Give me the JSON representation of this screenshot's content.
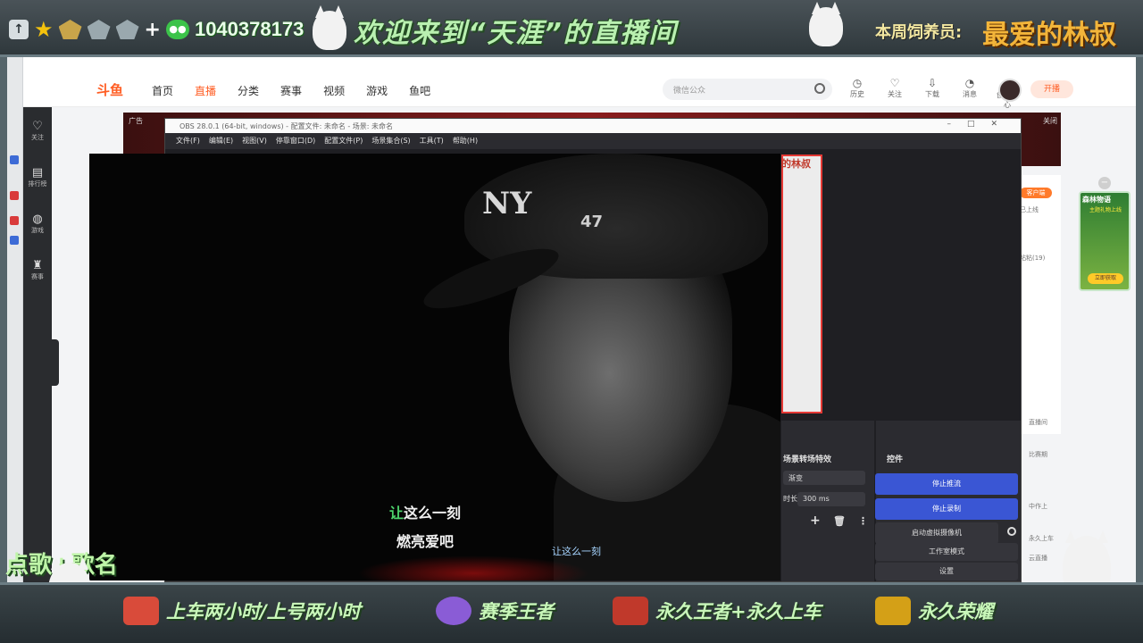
{
  "overlay": {
    "wechat_number": "1040378173",
    "welcome": "欢迎来到“天涯”的直播间",
    "feeder_label": "本周饲养员:",
    "feeder_name": "最爱的林叔",
    "song_request": "点歌+歌名",
    "rewards": [
      {
        "text": "上车两小时/上号两小时",
        "icon": "jet-icon",
        "color": "#d94b3a"
      },
      {
        "text": "赛季王者",
        "icon": "king-badge-icon",
        "color": "#8a5cd6"
      },
      {
        "text": "永久王者+永久上车",
        "icon": "rocket-icon",
        "color": "#c0392b"
      },
      {
        "text": "永久荣耀",
        "icon": "golden-rocket-icon",
        "color": "#d4a017"
      }
    ]
  },
  "site": {
    "logo": "斗鱼",
    "nav": [
      "首页",
      "直播",
      "分类",
      "赛事",
      "视频",
      "游戏",
      "鱼吧"
    ],
    "search_placeholder": "微信公众",
    "tools": [
      "历史",
      "关注",
      "下载",
      "消息",
      "创作中心"
    ],
    "live_button": "开播",
    "sidebar": [
      "关注",
      "排行榜",
      "游戏",
      "赛事"
    ],
    "ad_label": "广告",
    "close_label": "关闭",
    "client_button": "客户端",
    "panel_texts": [
      "已上线",
      "粘粘(19)",
      "直播间",
      "比赛期",
      "中作上",
      "永久上车",
      "云直播"
    ],
    "game_ad": {
      "title": "森林物语",
      "subtitle": "主题礼物上线",
      "button": "立即获取"
    }
  },
  "obs": {
    "title": "OBS 28.0.1 (64-bit, windows) - 配置文件: 未命名 - 场景: 未命名",
    "menu": [
      "文件(F)",
      "编辑(E)",
      "视图(V)",
      "停靠窗口(D)",
      "配置文件(P)",
      "场景集合(S)",
      "工具(T)",
      "帮助(H)"
    ],
    "preview_label": "的林叔",
    "transitions_title": "场景转场特效",
    "transition_value": "渐变",
    "duration_label": "时长",
    "duration_value": "300 ms",
    "controls_title": "控件",
    "buttons": [
      "停止推流",
      "停止录制",
      "启动虚拟摄像机",
      "工作室模式",
      "设置"
    ]
  },
  "video": {
    "lyric_highlight": "让",
    "lyric_line1_rest": "这么一刻",
    "lyric_line2": "燃亮爱吧",
    "lyric_small": "让这么一刻",
    "cap_logo": "NY",
    "cap_number": "47"
  }
}
